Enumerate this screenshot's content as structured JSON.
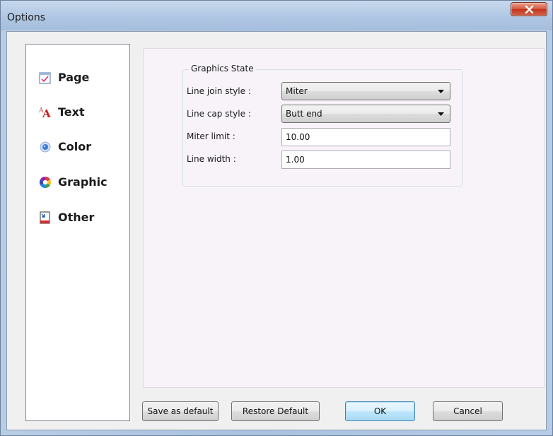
{
  "window": {
    "title": "Options",
    "close_glyph": "x"
  },
  "colors": {
    "title_gradient": "#b0c8e4",
    "close_button": "#c9452a",
    "default_button_border": "#3c7fb1",
    "content_background": "#f7f3f9"
  },
  "sidebar": {
    "items": [
      {
        "label": "Page",
        "icon": "page-icon"
      },
      {
        "label": "Text",
        "icon": "text-icon"
      },
      {
        "label": "Color",
        "icon": "color-icon"
      },
      {
        "label": "Graphic",
        "icon": "graphic-icon"
      },
      {
        "label": "Other",
        "icon": "other-icon"
      }
    ]
  },
  "graphics_state": {
    "title": "Graphics State",
    "line_join": {
      "label": "Line join style :",
      "value": "Miter"
    },
    "line_cap": {
      "label": "Line cap style :",
      "value": "Butt end"
    },
    "miter_limit": {
      "label": "Miter limit :",
      "value": "10.00"
    },
    "line_width": {
      "label": "Line width :",
      "value": "1.00"
    }
  },
  "buttons": {
    "save_default": "Save as default",
    "restore_default": "Restore Default",
    "ok": "OK",
    "cancel": "Cancel"
  }
}
